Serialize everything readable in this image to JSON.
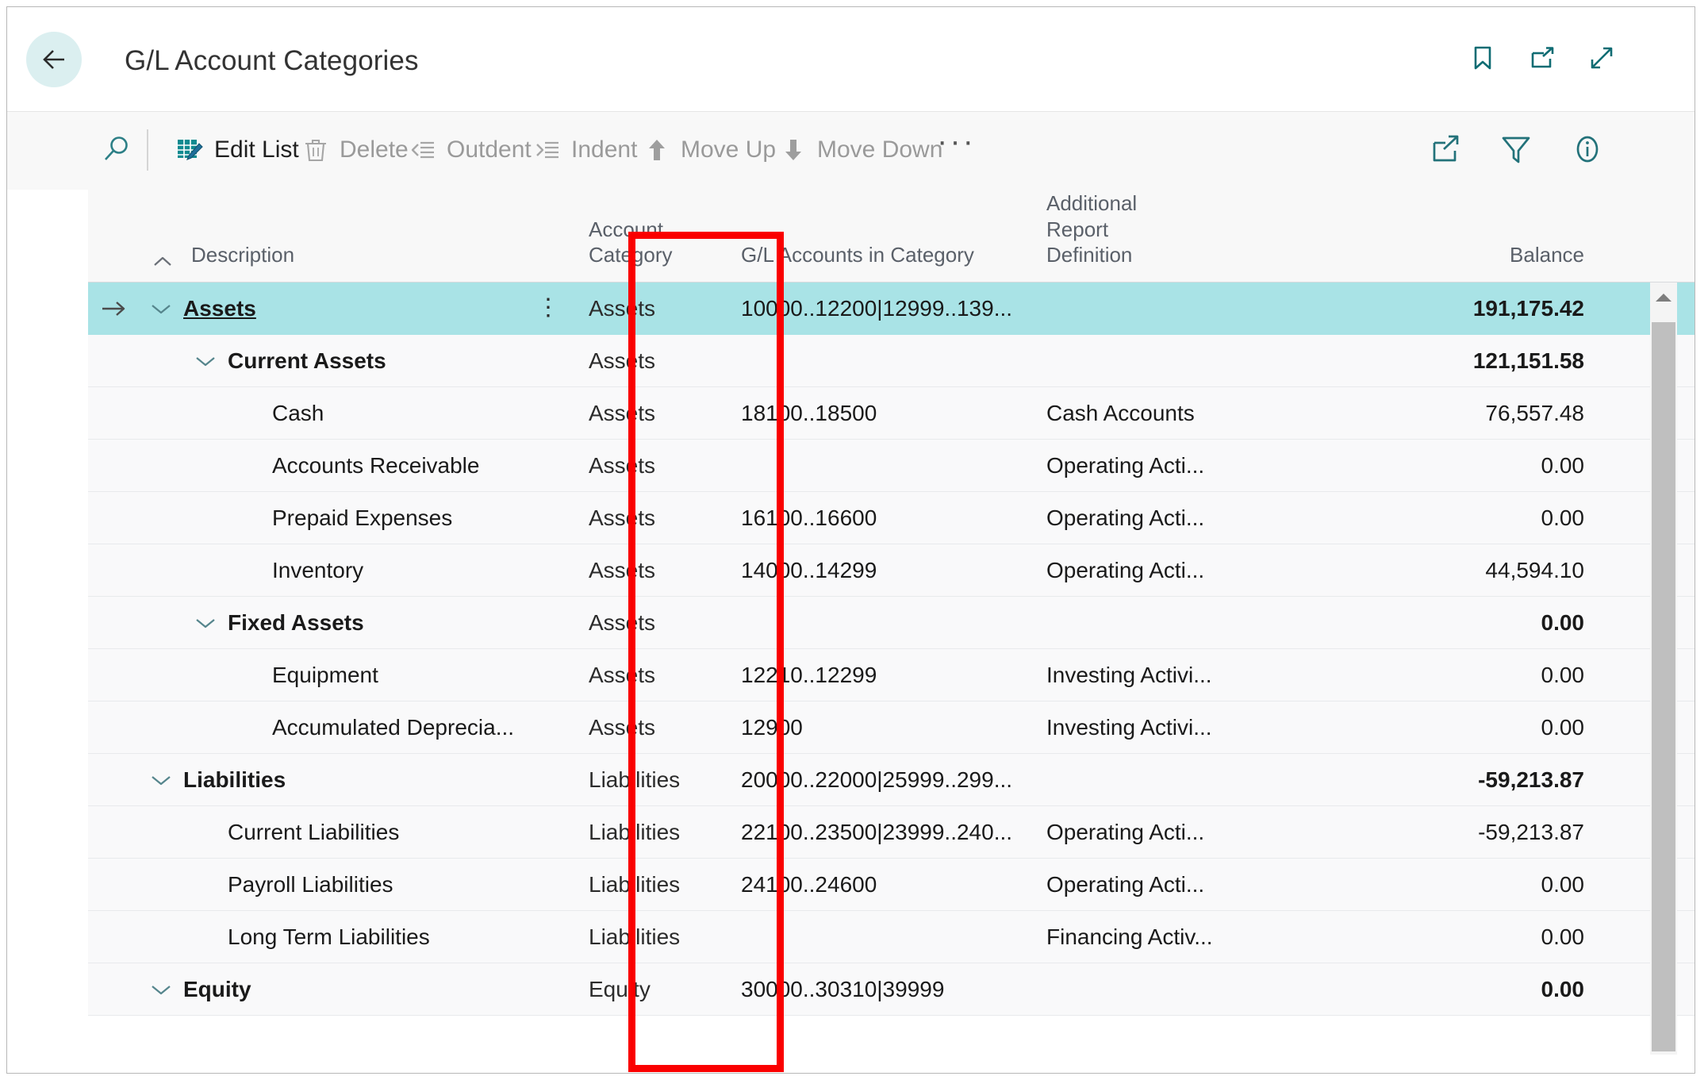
{
  "window": {
    "title": "G/L Account Categories"
  },
  "title_bar": {
    "back_tooltip": "Back",
    "icons": [
      "bookmark-icon",
      "open-in-new-window-icon",
      "expand-icon"
    ]
  },
  "command_bar": {
    "search_label": "",
    "items": [
      {
        "name": "search",
        "label": "",
        "enabled": true
      },
      {
        "name": "edit-list",
        "label": "Edit List",
        "enabled": true
      },
      {
        "name": "delete",
        "label": "Delete",
        "enabled": false
      },
      {
        "name": "outdent",
        "label": "Outdent",
        "enabled": false
      },
      {
        "name": "indent",
        "label": "Indent",
        "enabled": false
      },
      {
        "name": "move-up",
        "label": "Move Up",
        "enabled": false
      },
      {
        "name": "move-down",
        "label": "Move Down",
        "enabled": false
      },
      {
        "name": "more",
        "label": "···",
        "enabled": true
      }
    ],
    "edit_list_label": "Edit List",
    "delete_label": "Delete",
    "outdent_label": "Outdent",
    "indent_label": "Indent",
    "move_up_label": "Move Up",
    "move_down_label": "Move Down",
    "more_label": "···",
    "right_icons": [
      "share-icon",
      "filter-icon",
      "info-icon"
    ]
  },
  "grid": {
    "columns": [
      {
        "key": "description",
        "label": "Description",
        "align": "left"
      },
      {
        "key": "account_category",
        "label": "Account Category",
        "align": "left"
      },
      {
        "key": "gl_accounts",
        "label": "G/L Accounts in Category",
        "align": "left"
      },
      {
        "key": "additional_report_definition",
        "label": "Additional Report Definition",
        "align": "left"
      },
      {
        "key": "balance",
        "label": "Balance",
        "align": "right"
      }
    ],
    "column_header_lines": {
      "description": "Description",
      "account_category_l1": "Account",
      "account_category_l2": "Category",
      "gl_accounts": "G/L Accounts in Category",
      "ard_l1": "Additional",
      "ard_l2": "Report",
      "ard_l3": "Definition",
      "balance": "Balance"
    },
    "sort_indicator": "ascending",
    "rows": [
      {
        "description": "Assets",
        "indent": 1,
        "expanded": true,
        "bold": true,
        "link": true,
        "selected": true,
        "account_category": "Assets",
        "gl_accounts": "10000..12200|12999..139...",
        "additional_report_definition": "",
        "balance": "191,175.42"
      },
      {
        "description": "Current Assets",
        "indent": 2,
        "expanded": true,
        "bold": true,
        "link": false,
        "selected": false,
        "account_category": "Assets",
        "gl_accounts": "",
        "additional_report_definition": "",
        "balance": "121,151.58"
      },
      {
        "description": "Cash",
        "indent": 3,
        "expanded": null,
        "bold": false,
        "link": false,
        "selected": false,
        "account_category": "Assets",
        "gl_accounts": "18100..18500",
        "additional_report_definition": "Cash Accounts",
        "balance": "76,557.48"
      },
      {
        "description": "Accounts Receivable",
        "indent": 3,
        "expanded": null,
        "bold": false,
        "link": false,
        "selected": false,
        "account_category": "Assets",
        "gl_accounts": "",
        "additional_report_definition": "Operating Acti...",
        "balance": "0.00"
      },
      {
        "description": "Prepaid Expenses",
        "indent": 3,
        "expanded": null,
        "bold": false,
        "link": false,
        "selected": false,
        "account_category": "Assets",
        "gl_accounts": "16100..16600",
        "additional_report_definition": "Operating Acti...",
        "balance": "0.00"
      },
      {
        "description": "Inventory",
        "indent": 3,
        "expanded": null,
        "bold": false,
        "link": false,
        "selected": false,
        "account_category": "Assets",
        "gl_accounts": "14000..14299",
        "additional_report_definition": "Operating Acti...",
        "balance": "44,594.10"
      },
      {
        "description": "Fixed Assets",
        "indent": 2,
        "expanded": true,
        "bold": true,
        "link": false,
        "selected": false,
        "account_category": "Assets",
        "gl_accounts": "",
        "additional_report_definition": "",
        "balance": "0.00"
      },
      {
        "description": "Equipment",
        "indent": 3,
        "expanded": null,
        "bold": false,
        "link": false,
        "selected": false,
        "account_category": "Assets",
        "gl_accounts": "12210..12299",
        "additional_report_definition": "Investing Activi...",
        "balance": "0.00"
      },
      {
        "description": "Accumulated Deprecia...",
        "indent": 3,
        "expanded": null,
        "bold": false,
        "link": false,
        "selected": false,
        "account_category": "Assets",
        "gl_accounts": "12900",
        "additional_report_definition": "Investing Activi...",
        "balance": "0.00"
      },
      {
        "description": "Liabilities",
        "indent": 1,
        "expanded": true,
        "bold": true,
        "link": false,
        "selected": false,
        "account_category": "Liabilities",
        "gl_accounts": "20000..22000|25999..299...",
        "additional_report_definition": "",
        "balance": "-59,213.87"
      },
      {
        "description": "Current Liabilities",
        "indent": 2,
        "expanded": null,
        "bold": false,
        "link": false,
        "selected": false,
        "account_category": "Liabilities",
        "gl_accounts": "22100..23500|23999..240...",
        "additional_report_definition": "Operating Acti...",
        "balance": "-59,213.87"
      },
      {
        "description": "Payroll Liabilities",
        "indent": 2,
        "expanded": null,
        "bold": false,
        "link": false,
        "selected": false,
        "account_category": "Liabilities",
        "gl_accounts": "24100..24600",
        "additional_report_definition": "Operating Acti...",
        "balance": "0.00"
      },
      {
        "description": "Long Term Liabilities",
        "indent": 2,
        "expanded": null,
        "bold": false,
        "link": false,
        "selected": false,
        "account_category": "Liabilities",
        "gl_accounts": "",
        "additional_report_definition": "Financing Activ...",
        "balance": "0.00"
      },
      {
        "description": "Equity",
        "indent": 1,
        "expanded": true,
        "bold": true,
        "link": false,
        "selected": false,
        "account_category": "Equity",
        "gl_accounts": "30000..30310|39999",
        "additional_report_definition": "",
        "balance": "0.00"
      }
    ],
    "row_menu_glyph": "⋮"
  },
  "annotation": {
    "color": "#fa0000",
    "target_column": "Account Category"
  },
  "colors": {
    "accent": "#0f6c73",
    "selected_row": "#a9e3e6",
    "back_circle": "#dbeff0",
    "command_bar_bg": "#f8f8f8",
    "row_bg": "#f9f9fa",
    "annotation": "#fa0000"
  }
}
